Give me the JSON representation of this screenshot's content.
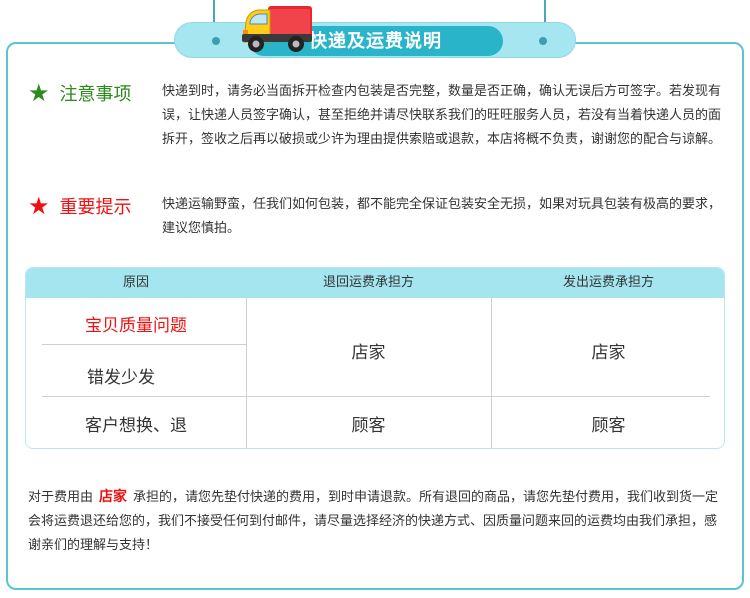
{
  "header": {
    "title": "快递及运费说明",
    "truck_icon": "delivery-truck-icon",
    "colors": {
      "accent": "#2ab4ca",
      "accent_light": "#a6e6f0",
      "border": "#5bc4cf"
    }
  },
  "notes": [
    {
      "icon": "star-icon",
      "color": "#2d8a1d",
      "label": "注意事项",
      "text": "快递到时，请务必当面拆开检查内包装是否完整，数量是否正确，确认无误后方可签字。若发现有误，让快递人员签字确认，甚至拒绝并请尽快联系我们的旺旺服务人员，若没有当着快递人员的面拆开，签收之后再以破损或少许为理由提供索赔或退款，本店将概不负责，谢谢您的配合与谅解。"
    },
    {
      "icon": "star-icon",
      "color": "#e11111",
      "label": "重要提示",
      "text": "快递运输野蛮，任我们如何包装，都不能完全保证包装安全无损，如果对玩具包装有极高的要求，建议您慎拍。"
    }
  ],
  "table": {
    "headers": [
      "原因",
      "退回运费承担方",
      "发出运费承担方"
    ],
    "rows": [
      {
        "reasons": [
          "宝贝质量问题",
          "错发少发"
        ],
        "return_party": "店家",
        "send_party": "店家"
      },
      {
        "reasons": [
          "客户想换、退"
        ],
        "return_party": "顾客",
        "send_party": "顾客"
      }
    ]
  },
  "footer": {
    "prefix": "对于费用由",
    "highlight": "店家",
    "suffix": "承担的，请您先垫付快递的费用，到时申请退款。所有退回的商品，请您先垫付费用，我们收到货一定会将运费退还给您的，我们不接受任何到付邮件，请尽量选择经济的快递方式、因质量问题来回的运费均由我们承担，感谢亲们的理解与支持！"
  }
}
